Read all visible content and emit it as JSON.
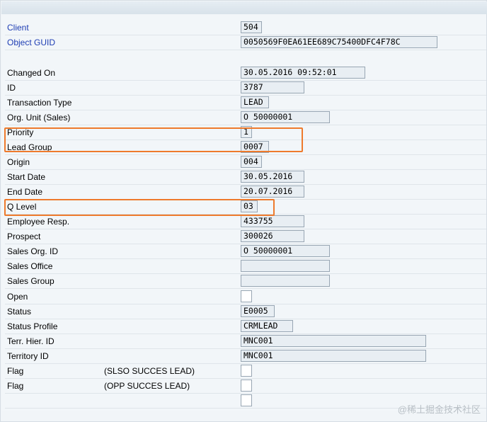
{
  "fields": [
    {
      "label": "Client",
      "link": true,
      "value": "504",
      "w": 30
    },
    {
      "label": "Object GUID",
      "link": true,
      "value": "0050569F0EA61EE689C75400DFC4F78C",
      "w": 278
    },
    {
      "label": "Changed On",
      "value": "30.05.2016 09:52:01",
      "w": 176
    },
    {
      "label": "ID",
      "value": "3787",
      "w": 90
    },
    {
      "label": "Transaction Type",
      "value": "LEAD",
      "w": 40
    },
    {
      "label": "Org. Unit (Sales)",
      "value": "O 50000001",
      "w": 126
    },
    {
      "label": "Priority",
      "value": "1",
      "w": 16
    },
    {
      "label": "Lead Group",
      "value": "0007",
      "w": 40
    },
    {
      "label": "Origin",
      "value": "004",
      "w": 30
    },
    {
      "label": "Start Date",
      "value": "30.05.2016",
      "w": 90
    },
    {
      "label": "End Date",
      "value": "20.07.2016",
      "w": 90
    },
    {
      "label": "Q Level",
      "value": "03",
      "w": 24
    },
    {
      "label": "Employee Resp.",
      "value": "433755",
      "w": 90
    },
    {
      "label": "Prospect",
      "value": "300026",
      "w": 90
    },
    {
      "label": "Sales Org. ID",
      "value": "O 50000001",
      "w": 126
    },
    {
      "label": "Sales Office",
      "value": "",
      "w": 126
    },
    {
      "label": "Sales Group",
      "value": "",
      "w": 126
    },
    {
      "label": "Open",
      "value": "",
      "w": 16
    },
    {
      "label": "Status",
      "value": "E0005",
      "w": 48
    },
    {
      "label": "Status Profile",
      "value": "CRMLEAD",
      "w": 74
    },
    {
      "label": "Terr. Hier. ID",
      "value": "MNC001",
      "w": 262
    },
    {
      "label": "Territory ID",
      "value": "MNC001",
      "w": 262
    },
    {
      "label": "Flag",
      "sub": "(SLSO SUCCES LEAD)",
      "value": "",
      "w": 16
    },
    {
      "label": "Flag",
      "sub": "(OPP SUCCES LEAD)",
      "value": "",
      "w": 16
    },
    {
      "label": "",
      "value": "",
      "w": 16
    }
  ],
  "watermark": "@稀土掘金技术社区",
  "highlight_color": "#ee7a2c"
}
